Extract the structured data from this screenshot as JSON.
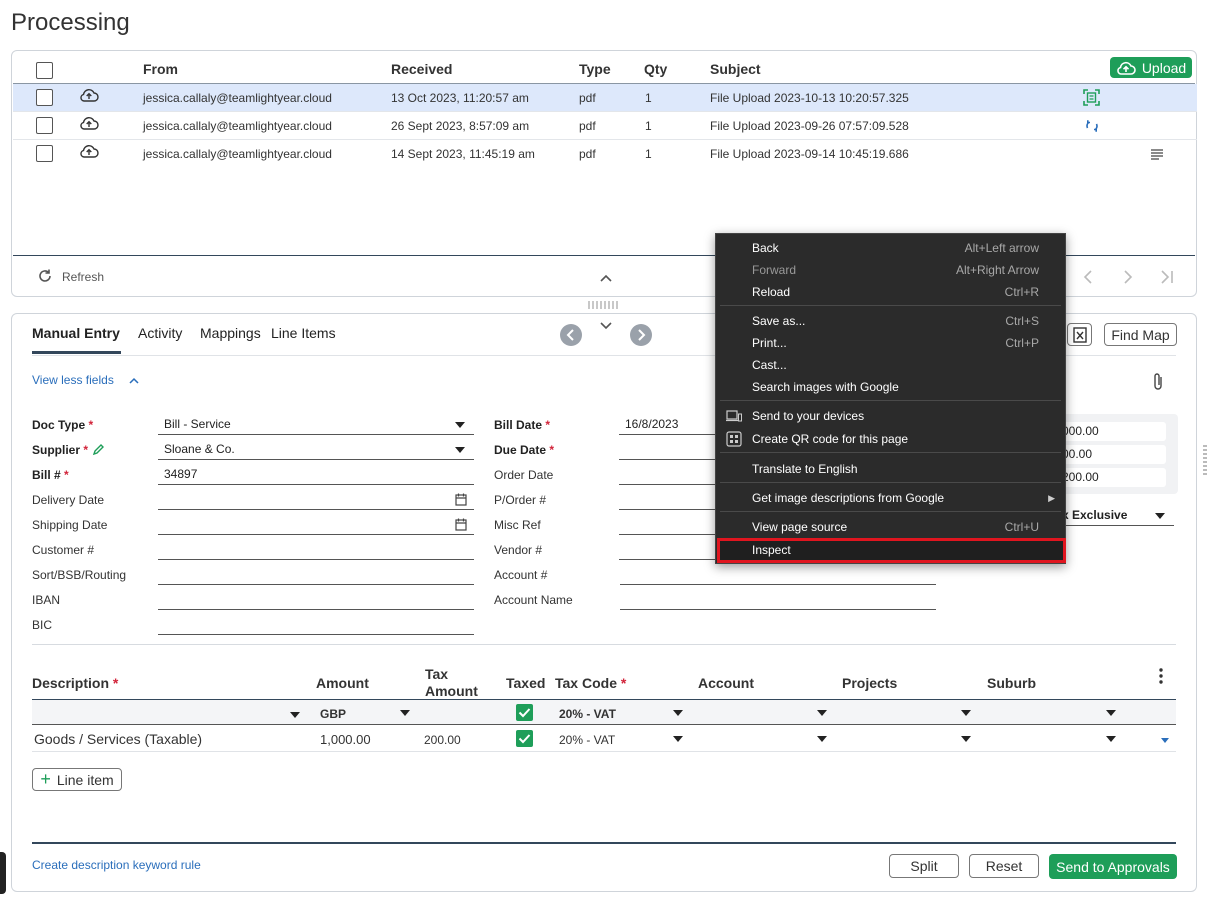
{
  "page_title": "Processing",
  "inbox": {
    "upload_label": "Upload",
    "columns": {
      "from": "From",
      "received": "Received",
      "type": "Type",
      "qty": "Qty",
      "subject": "Subject"
    },
    "rows": [
      {
        "from": "jessica.callaly@teamlightyear.cloud",
        "received": "13 Oct 2023, 11:20:57 am",
        "type": "pdf",
        "qty": "1",
        "subject": "File Upload 2023-10-13 10:20:57.325",
        "status_icon": "scan-icon",
        "selected": true
      },
      {
        "from": "jessica.callaly@teamlightyear.cloud",
        "received": "26 Sept 2023, 8:57:09 am",
        "type": "pdf",
        "qty": "1",
        "subject": "File Upload 2023-09-26 07:57:09.528",
        "status_icon": "sync-icon",
        "selected": false
      },
      {
        "from": "jessica.callaly@teamlightyear.cloud",
        "received": "14 Sept 2023, 11:45:19 am",
        "type": "pdf",
        "qty": "1",
        "subject": "File Upload 2023-09-14 10:45:19.686",
        "status_icon": "list-icon",
        "selected": false
      }
    ],
    "refresh_label": "Refresh"
  },
  "tabs": [
    "Manual Entry",
    "Activity",
    "Mappings",
    "Line Items"
  ],
  "find_map_label": "Find Map",
  "view_less_label": "View less fields",
  "form": {
    "doc_type_label": "Doc Type",
    "doc_type_value": "Bill - Service",
    "supplier_label": "Supplier",
    "supplier_value": "Sloane & Co.",
    "bill_no_label": "Bill #",
    "bill_no_value": "34897",
    "delivery_date_label": "Delivery Date",
    "shipping_date_label": "Shipping Date",
    "customer_label": "Customer #",
    "sort_label": "Sort/BSB/Routing",
    "iban_label": "IBAN",
    "bic_label": "BIC",
    "bill_date_label": "Bill Date",
    "bill_date_value": "16/8/2023",
    "due_date_label": "Due Date",
    "order_date_label": "Order Date",
    "porder_label": "P/Order #",
    "misc_ref_label": "Misc Ref",
    "vendor_label": "Vendor #",
    "account_no_label": "Account #",
    "account_name_label": "Account Name"
  },
  "totals": {
    "subtotal": "000.00",
    "tax": "00.00",
    "total": "200.00",
    "tax_mode": "x Exclusive"
  },
  "lines": {
    "headers": {
      "description": "Description",
      "amount": "Amount",
      "tax_amount_1": "Tax",
      "tax_amount_2": "Amount",
      "taxed": "Taxed",
      "tax_code": "Tax Code",
      "account": "Account",
      "projects": "Projects",
      "suburb": "Suburb"
    },
    "defaults": {
      "currency": "GBP",
      "tax_code": "20% - VAT"
    },
    "rows": [
      {
        "description": "Goods / Services (Taxable)",
        "amount": "1,000.00",
        "tax_amount": "200.00",
        "tax_code": "20% - VAT"
      }
    ],
    "add_line_label": "Line item"
  },
  "footer": {
    "keyword_rule_label": "Create description keyword rule",
    "split_label": "Split",
    "reset_label": "Reset",
    "send_label": "Send to Approvals"
  },
  "context_menu": {
    "back": "Back",
    "back_key": "Alt+Left arrow",
    "forward": "Forward",
    "forward_key": "Alt+Right Arrow",
    "reload": "Reload",
    "reload_key": "Ctrl+R",
    "save_as": "Save as...",
    "save_as_key": "Ctrl+S",
    "print": "Print...",
    "print_key": "Ctrl+P",
    "cast": "Cast...",
    "search_images": "Search images with Google",
    "send_devices": "Send to your devices",
    "qr_code": "Create QR code for this page",
    "translate": "Translate to English",
    "image_desc": "Get image descriptions from Google",
    "view_source": "View page source",
    "view_source_key": "Ctrl+U",
    "inspect": "Inspect"
  },
  "colors": {
    "accent_green": "#1e9e59",
    "link_blue": "#2a6ebb",
    "selected_row": "#dde8fb",
    "highlight_red": "#e0151f"
  }
}
